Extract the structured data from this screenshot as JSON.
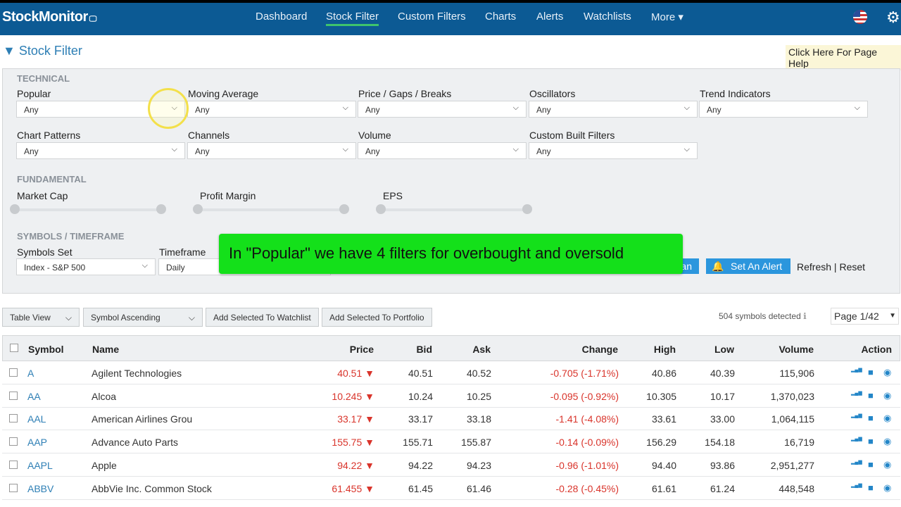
{
  "app": {
    "brand": "StockMonitor"
  },
  "nav": {
    "items": [
      "Dashboard",
      "Stock Filter",
      "Custom Filters",
      "Charts",
      "Alerts",
      "Watchlists",
      "More ▾"
    ],
    "active": "Stock Filter"
  },
  "page": {
    "title": "Stock Filter",
    "help": "Click Here For Page Help"
  },
  "technical": {
    "heading": "TECHNICAL",
    "filters": [
      {
        "label": "Popular",
        "value": "Any"
      },
      {
        "label": "Moving Average",
        "value": "Any"
      },
      {
        "label": "Price / Gaps / Breaks",
        "value": "Any"
      },
      {
        "label": "Oscillators",
        "value": "Any"
      },
      {
        "label": "Trend Indicators",
        "value": "Any"
      },
      {
        "label": "Chart Patterns",
        "value": "Any"
      },
      {
        "label": "Channels",
        "value": "Any"
      },
      {
        "label": "Volume",
        "value": "Any"
      },
      {
        "label": "Custom Built Filters",
        "value": "Any"
      }
    ]
  },
  "fundamental": {
    "heading": "FUNDAMENTAL",
    "sliders": [
      "Market Cap",
      "Profit Margin",
      "EPS"
    ]
  },
  "symbols": {
    "heading": "SYMBOLS / TIMEFRAME",
    "set_label": "Symbols Set",
    "set_value": "Index - S&P 500",
    "timeframe_label": "Timeframe",
    "timeframe_value": "Daily",
    "scan_label": "an",
    "alert_label": "Set An Alert",
    "refresh": "Refresh",
    "reset": "Reset"
  },
  "overlay": "In \"Popular\" we have 4 filters for overbought and oversold",
  "toolbar": {
    "view": "Table View",
    "sort": "Symbol Ascending",
    "watchlist": "Add Selected To Watchlist",
    "portfolio": "Add Selected To Portfolio",
    "count": "504 symbols detected",
    "page": "Page 1/42"
  },
  "table": {
    "headers": [
      "Symbol",
      "Name",
      "Price",
      "Bid",
      "Ask",
      "Change",
      "High",
      "Low",
      "Volume",
      "Action"
    ],
    "rows": [
      [
        "A",
        "Agilent Technologies",
        "40.51 ▼",
        "40.51",
        "40.52",
        "-0.705 (-1.71%)",
        "40.86",
        "40.39",
        "115,906"
      ],
      [
        "AA",
        "Alcoa",
        "10.245 ▼",
        "10.24",
        "10.25",
        "-0.095 (-0.92%)",
        "10.305",
        "10.17",
        "1,370,023"
      ],
      [
        "AAL",
        "American Airlines Grou",
        "33.17 ▼",
        "33.17",
        "33.18",
        "-1.41 (-4.08%)",
        "33.61",
        "33.00",
        "1,064,115"
      ],
      [
        "AAP",
        "Advance Auto Parts",
        "155.75 ▼",
        "155.71",
        "155.87",
        "-0.14 (-0.09%)",
        "156.29",
        "154.18",
        "16,719"
      ],
      [
        "AAPL",
        "Apple",
        "94.22 ▼",
        "94.22",
        "94.23",
        "-0.96 (-1.01%)",
        "94.40",
        "93.86",
        "2,951,277"
      ],
      [
        "ABBV",
        "AbbVie Inc. Common Stock",
        "61.455 ▼",
        "61.45",
        "61.46",
        "-0.28 (-0.45%)",
        "61.61",
        "61.24",
        "448,548"
      ]
    ]
  },
  "colors": {
    "nav": "#0c5a94",
    "accent": "#2e7fb5",
    "down": "#d9342b",
    "overlay": "#14e01a"
  }
}
